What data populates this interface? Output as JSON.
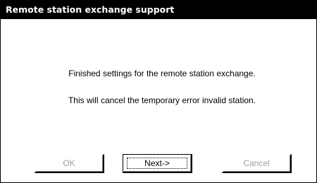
{
  "window": {
    "title": "Remote station exchange support"
  },
  "message": {
    "line1": "Finished settings for the remote station exchange.",
    "line2": "This will cancel the temporary error invalid station."
  },
  "buttons": {
    "ok_label": "OK",
    "ok_enabled": false,
    "next_label": "Next->",
    "next_enabled": true,
    "cancel_label": "Cancel",
    "cancel_enabled": false
  },
  "colors": {
    "titlebar_bg": "#000000",
    "titlebar_text": "#ffffff",
    "disabled_text": "#a0a0a0"
  }
}
